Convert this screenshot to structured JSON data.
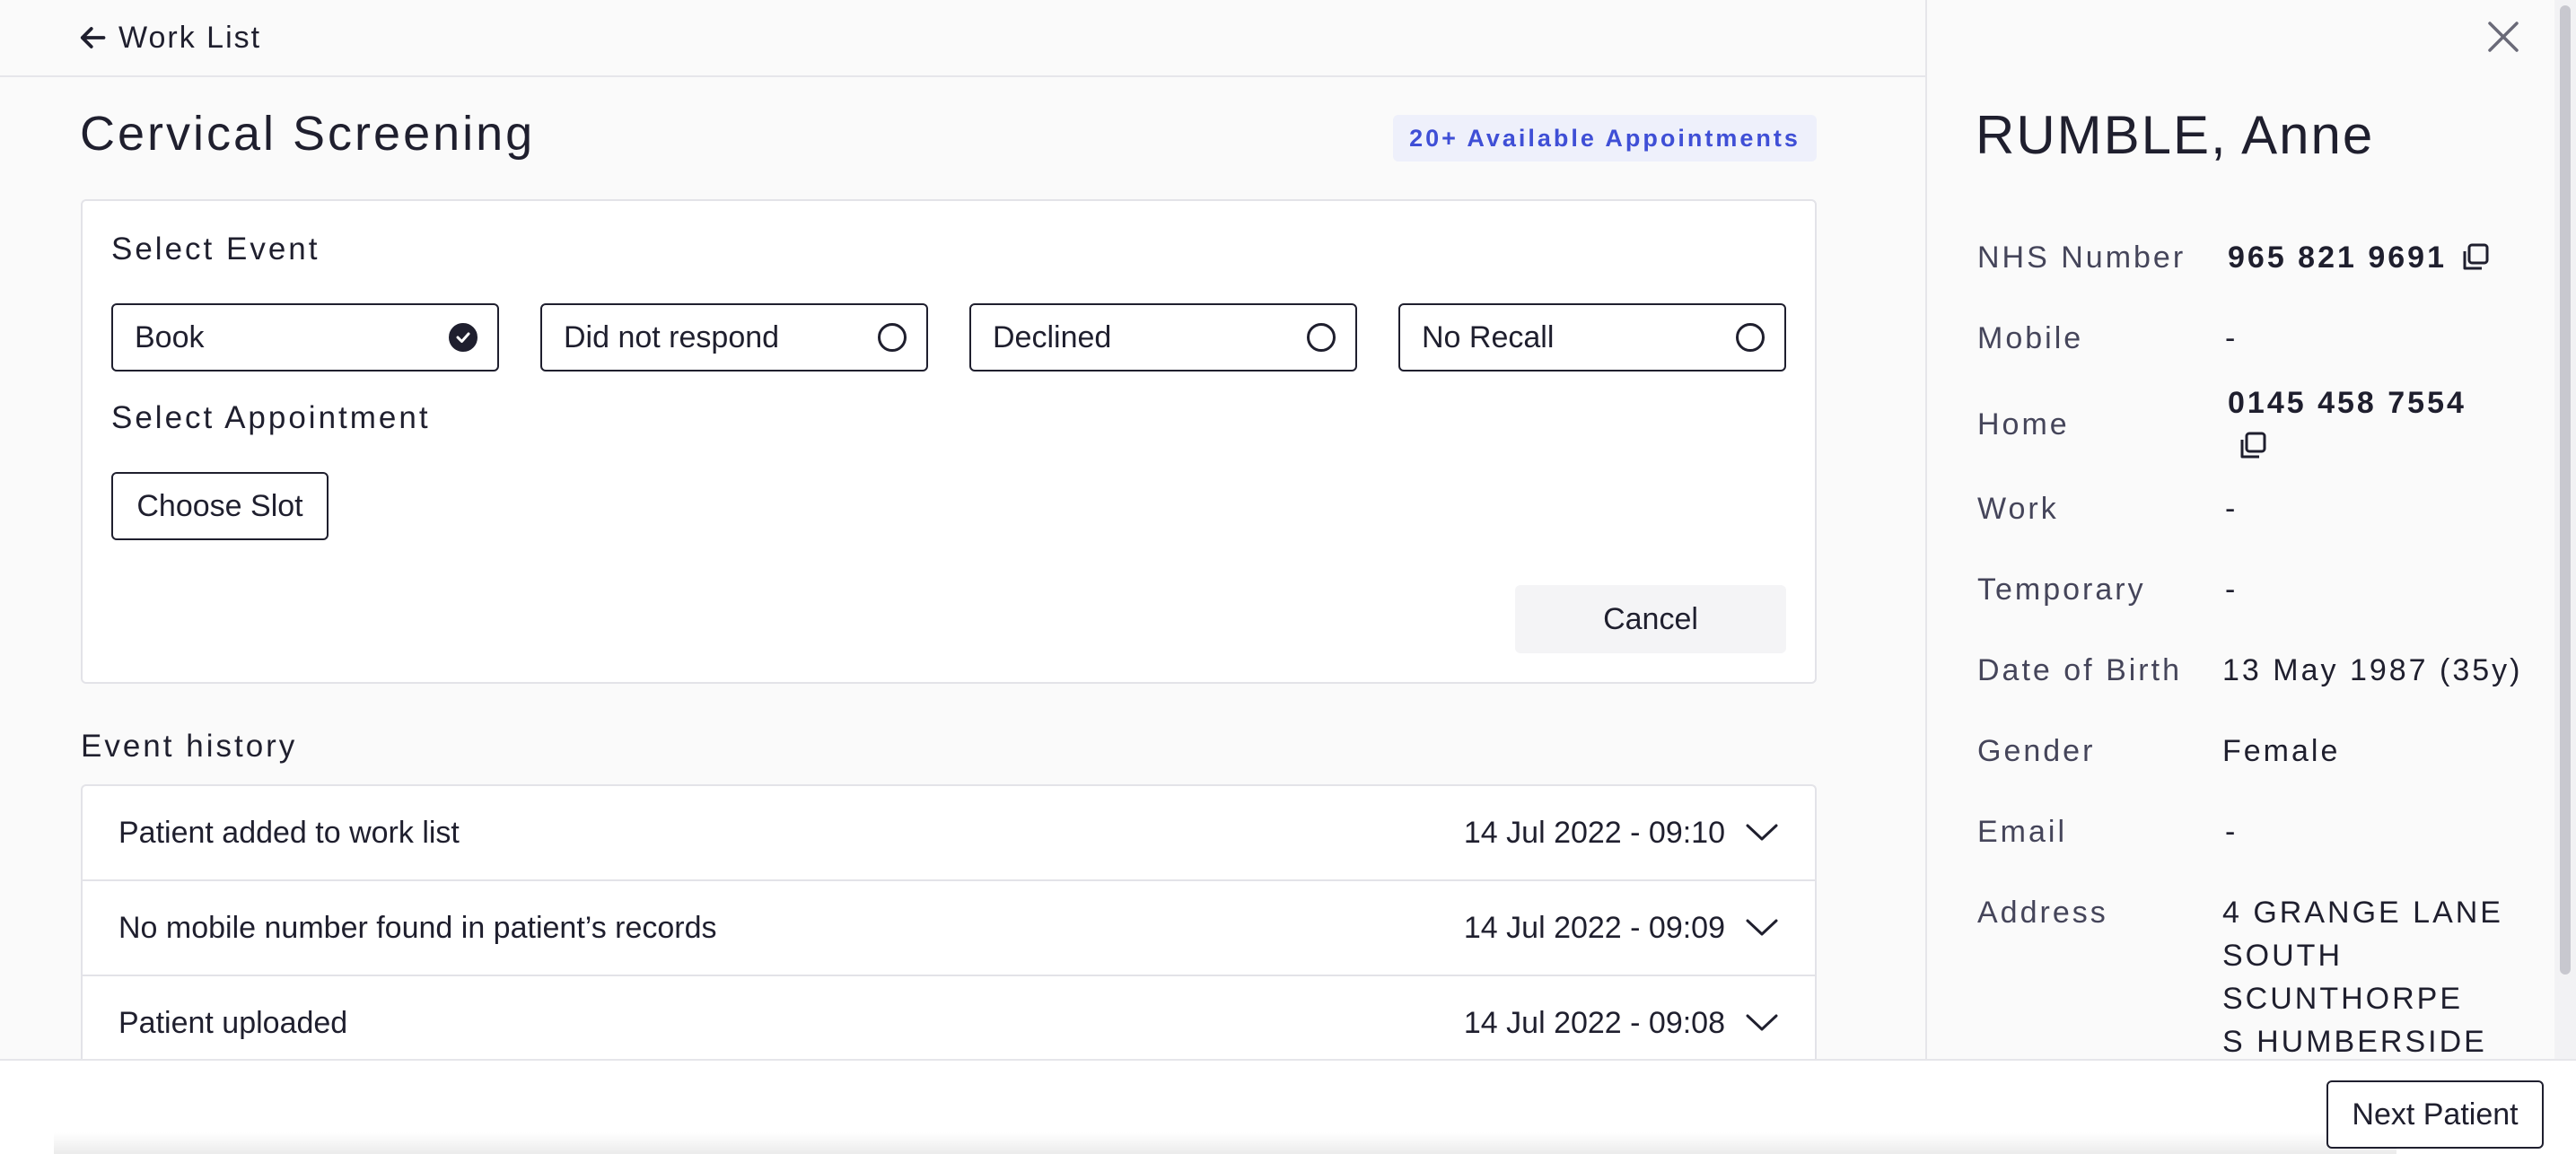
{
  "header": {
    "back_label": "Work List"
  },
  "main": {
    "title": "Cervical Screening",
    "badge": "20+ Available Appointments",
    "select_event_label": "Select Event",
    "event_options": [
      {
        "label": "Book",
        "selected": true
      },
      {
        "label": "Did not respond",
        "selected": false
      },
      {
        "label": "Declined",
        "selected": false
      },
      {
        "label": "No Recall",
        "selected": false
      }
    ],
    "select_appointment_label": "Select Appointment",
    "choose_slot_label": "Choose Slot",
    "cancel_label": "Cancel"
  },
  "history": {
    "title": "Event history",
    "rows": [
      {
        "text": "Patient added to work list",
        "date": "14 Jul 2022 - 09:10"
      },
      {
        "text": "No mobile number found in patient’s records",
        "date": "14 Jul 2022 - 09:09"
      },
      {
        "text": "Patient uploaded",
        "date": "14 Jul 2022 - 09:08"
      }
    ]
  },
  "patient": {
    "name": "RUMBLE, Anne",
    "fields": {
      "nhs_number": {
        "label": "NHS Number",
        "value": "965 821 9691"
      },
      "mobile": {
        "label": "Mobile",
        "value": "-"
      },
      "home": {
        "label": "Home",
        "value": "0145 458 7554"
      },
      "work": {
        "label": "Work",
        "value": "-"
      },
      "temporary": {
        "label": "Temporary",
        "value": "-"
      },
      "dob": {
        "label": "Date of Birth",
        "value": "13 May 1987 (35y)"
      },
      "gender": {
        "label": "Gender",
        "value": "Female"
      },
      "email": {
        "label": "Email",
        "value": "-"
      },
      "address": {
        "label": "Address",
        "lines": [
          "4 GRANGE LANE",
          "SOUTH",
          "SCUNTHORPE",
          "S HUMBERSIDE"
        ]
      }
    }
  },
  "footer": {
    "next_patient_label": "Next Patient"
  },
  "colors": {
    "accent": "#3f4fd6",
    "badge_bg": "#eef0fb",
    "text": "#1f1f2e"
  }
}
